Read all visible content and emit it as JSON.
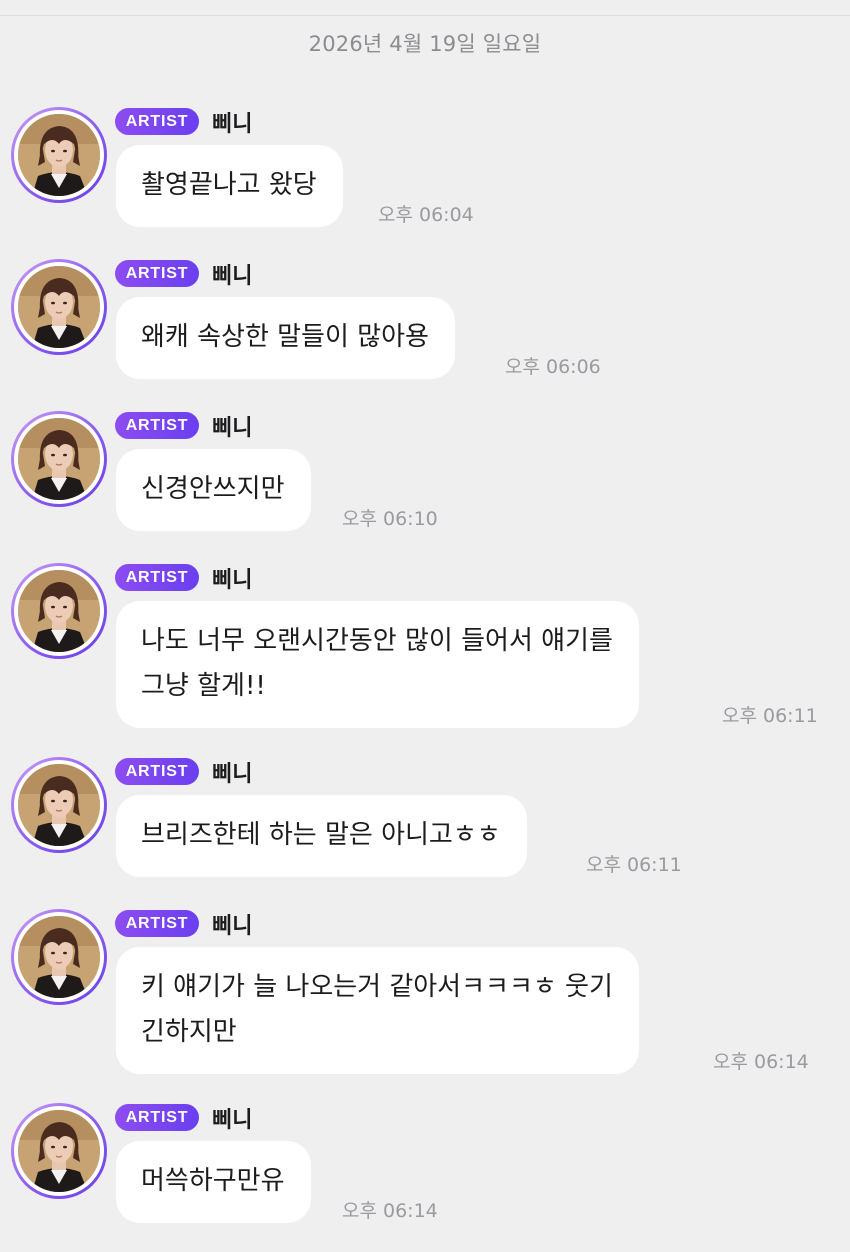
{
  "date_header": "2026년 4월 19일 일요일",
  "sender": {
    "badge": "ARTIST",
    "name": "삐니",
    "avatar_icon": "artist-profile-photo"
  },
  "colors": {
    "background": "#efeff0",
    "bubble": "#ffffff",
    "badge_gradient_start": "#8d4df0",
    "badge_gradient_end": "#6a3ff0",
    "avatar_ring": "#8a5cf0",
    "timestamp": "#9a9aa0"
  },
  "messages": [
    {
      "lines": [
        "촬영끝나고 왔당"
      ],
      "time": "오후 06:04"
    },
    {
      "lines": [
        "왜캐 속상한 말들이 많아용"
      ],
      "time": "오후 06:06"
    },
    {
      "lines": [
        "신경안쓰지만"
      ],
      "time": "오후 06:10"
    },
    {
      "lines": [
        "나도 너무 오랜시간동안 많이 들어서 얘기를",
        "그냥 할게!!"
      ],
      "time": "오후 06:11"
    },
    {
      "lines": [
        "브리즈한테 하는 말은 아니고ㅎㅎ"
      ],
      "time": "오후 06:11"
    },
    {
      "lines": [
        "키 얘기가 늘 나오는거 같아서ㅋㅋㅋㅎ 웃기",
        "긴하지만"
      ],
      "time": "오후 06:14"
    },
    {
      "lines": [
        "머쓱하구만유"
      ],
      "time": "오후 06:14"
    }
  ]
}
